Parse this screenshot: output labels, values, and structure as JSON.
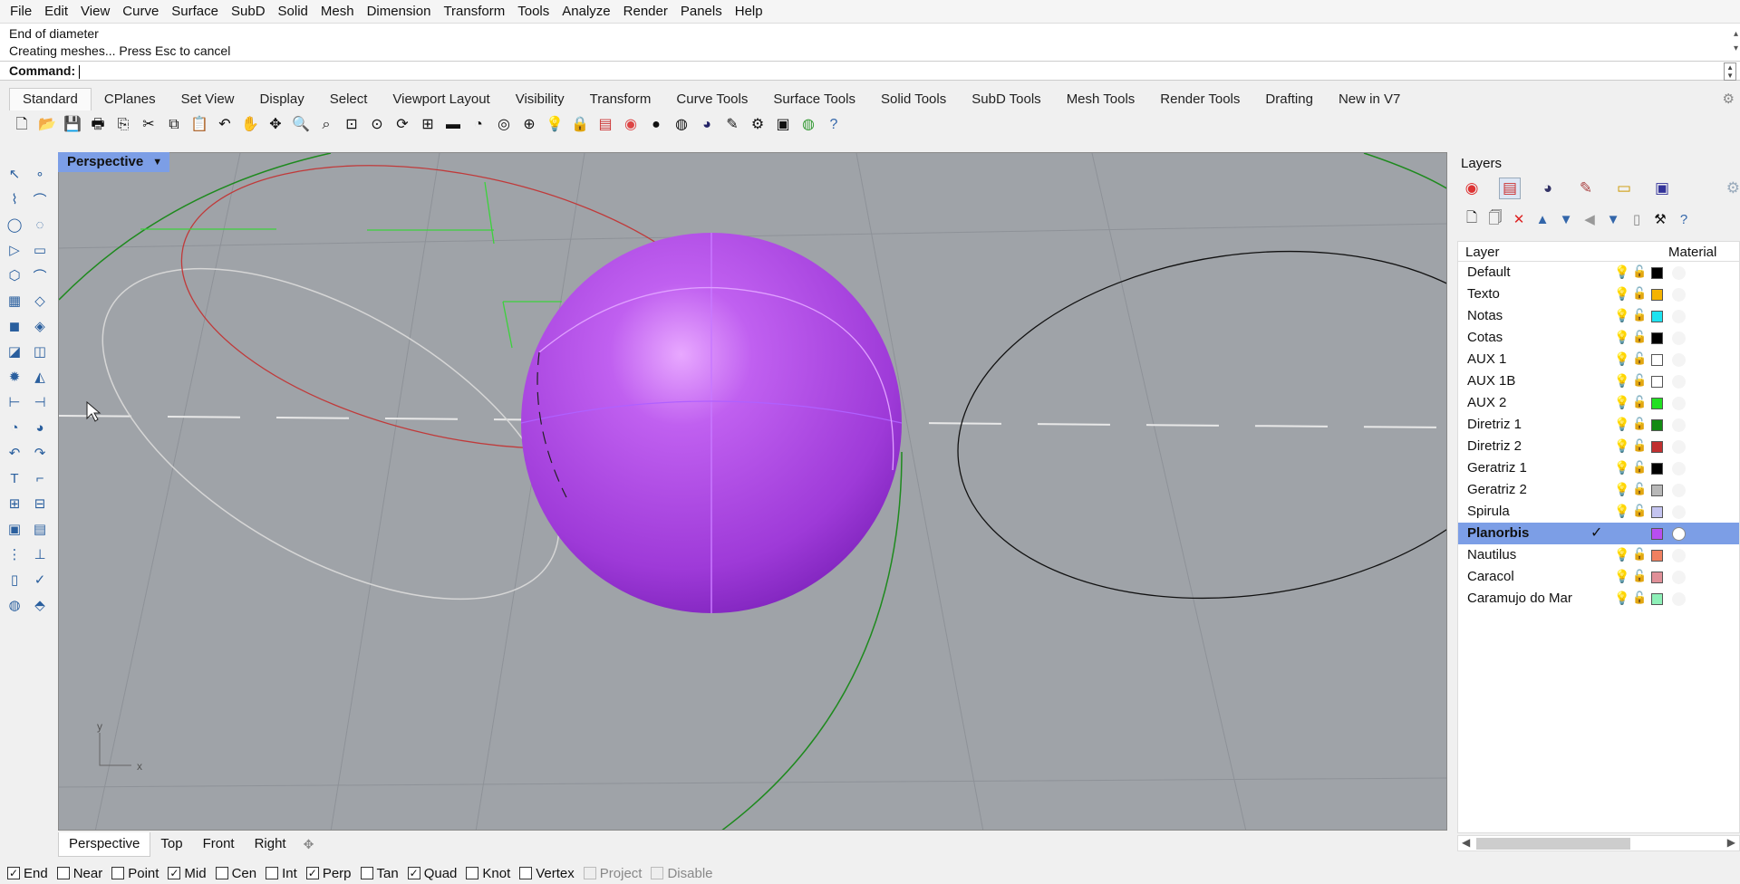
{
  "menu": [
    "File",
    "Edit",
    "View",
    "Curve",
    "Surface",
    "SubD",
    "Solid",
    "Mesh",
    "Dimension",
    "Transform",
    "Tools",
    "Analyze",
    "Render",
    "Panels",
    "Help"
  ],
  "command": {
    "history": [
      "End of diameter",
      "Creating meshes... Press Esc to cancel"
    ],
    "prompt_label": "Command:",
    "value": ""
  },
  "tabs": [
    "Standard",
    "CPlanes",
    "Set View",
    "Display",
    "Select",
    "Viewport Layout",
    "Visibility",
    "Transform",
    "Curve Tools",
    "Surface Tools",
    "Solid Tools",
    "SubD Tools",
    "Mesh Tools",
    "Render Tools",
    "Drafting",
    "New in V7"
  ],
  "active_tab": "Standard",
  "toolbar_icons": [
    "new-icon",
    "open-icon",
    "save-icon",
    "print-icon",
    "import-icon",
    "cut-icon",
    "copy-icon",
    "paste-icon",
    "undo-icon",
    "pan-icon",
    "move-view-icon",
    "zoom-icon",
    "zoom-window-icon",
    "zoom-extents-icon",
    "zoom-selected-icon",
    "rotate-view-icon",
    "four-viewports-icon",
    "car-icon",
    "camera-icon",
    "target-icon",
    "gumball-icon",
    "light-icon",
    "lock-icon",
    "layer-icon",
    "color-wheel-icon",
    "shaded-icon",
    "rendered-icon",
    "render-sphere-icon",
    "pen-icon",
    "settings-icon",
    "snapshot-icon",
    "globe-icon",
    "help-icon"
  ],
  "viewport": {
    "label": "Perspective",
    "axis_x": "x",
    "axis_y": "y",
    "sphere_color": "#a53ee0"
  },
  "viewport_tabs": [
    "Perspective",
    "Top",
    "Front",
    "Right"
  ],
  "active_viewport_tab": "Perspective",
  "osnaps": [
    {
      "label": "End",
      "checked": true,
      "enabled": true
    },
    {
      "label": "Near",
      "checked": false,
      "enabled": true
    },
    {
      "label": "Point",
      "checked": false,
      "enabled": true
    },
    {
      "label": "Mid",
      "checked": true,
      "enabled": true
    },
    {
      "label": "Cen",
      "checked": false,
      "enabled": true
    },
    {
      "label": "Int",
      "checked": false,
      "enabled": true
    },
    {
      "label": "Perp",
      "checked": true,
      "enabled": true
    },
    {
      "label": "Tan",
      "checked": false,
      "enabled": true
    },
    {
      "label": "Quad",
      "checked": true,
      "enabled": true
    },
    {
      "label": "Knot",
      "checked": false,
      "enabled": true
    },
    {
      "label": "Vertex",
      "checked": false,
      "enabled": true
    },
    {
      "label": "Project",
      "checked": false,
      "enabled": false
    },
    {
      "label": "Disable",
      "checked": false,
      "enabled": false
    }
  ],
  "layers_panel": {
    "title": "Layers",
    "column_layer": "Layer",
    "column_material": "Material",
    "rows": [
      {
        "name": "Default",
        "color": "#000000"
      },
      {
        "name": "Texto",
        "color": "#f5b300"
      },
      {
        "name": "Notas",
        "color": "#1ee3f0"
      },
      {
        "name": "Cotas",
        "color": "#000000"
      },
      {
        "name": "AUX 1",
        "color": "#ffffff"
      },
      {
        "name": "AUX 1B",
        "color": "#ffffff"
      },
      {
        "name": "AUX 2",
        "color": "#22e022"
      },
      {
        "name": "Diretriz 1",
        "color": "#138a13"
      },
      {
        "name": "Diretriz 2",
        "color": "#c03030"
      },
      {
        "name": "Geratriz 1",
        "color": "#000000"
      },
      {
        "name": "Geratriz 2",
        "color": "#b8b8b8"
      },
      {
        "name": "Spirula",
        "color": "#c4c4f0"
      },
      {
        "name": "Planorbis",
        "color": "#b84ef0",
        "current": true
      },
      {
        "name": "Nautilus",
        "color": "#f08060"
      },
      {
        "name": "Caracol",
        "color": "#e09098"
      },
      {
        "name": "Caramujo do Mar",
        "color": "#8ef0b8"
      }
    ]
  }
}
